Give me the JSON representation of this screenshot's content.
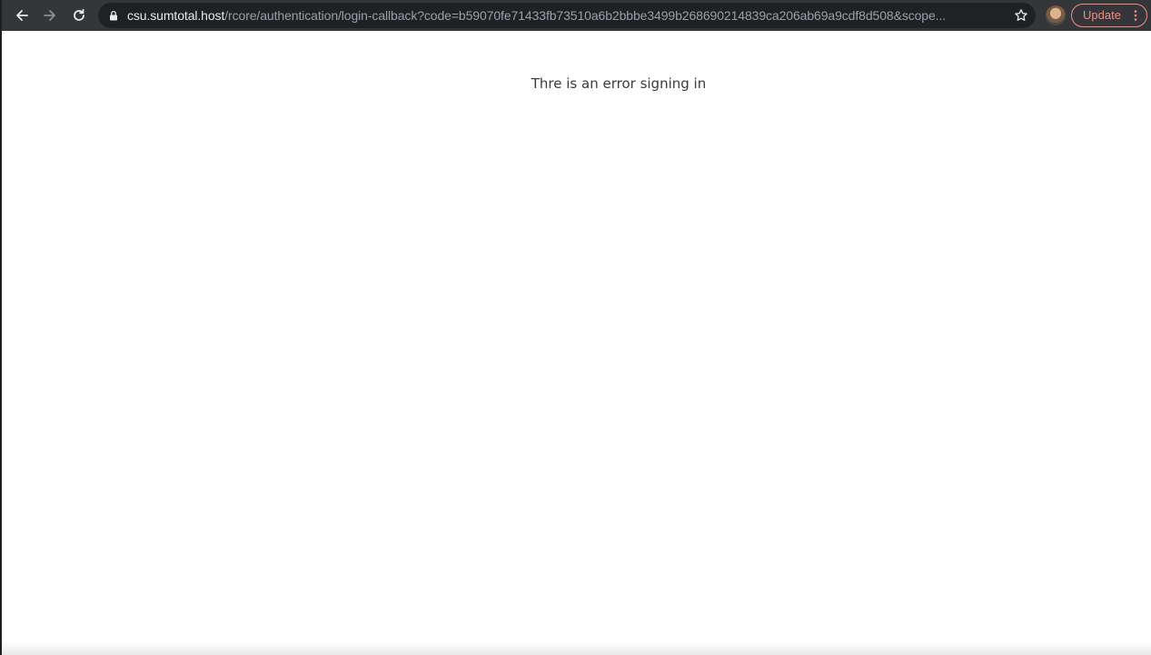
{
  "browser": {
    "url_host": "csu.sumtotal.host",
    "url_path": "/rcore/authentication/login-callback?code=b59070fe71433fb73510a6b2bbbe3499b268690214839ca206ab69a9cdf8d508&scope...",
    "update_label": "Update",
    "icons": {
      "back": "arrow-left-icon",
      "forward": "arrow-right-icon",
      "reload": "reload-icon",
      "lock": "lock-icon",
      "bookmark": "star-icon",
      "menu": "vertical-dots-icon"
    },
    "colors": {
      "toolbar": "#35363a",
      "omnibox": "#202124",
      "update_accent": "#f28b82"
    }
  },
  "page": {
    "message": "Thre is an error signing in"
  }
}
